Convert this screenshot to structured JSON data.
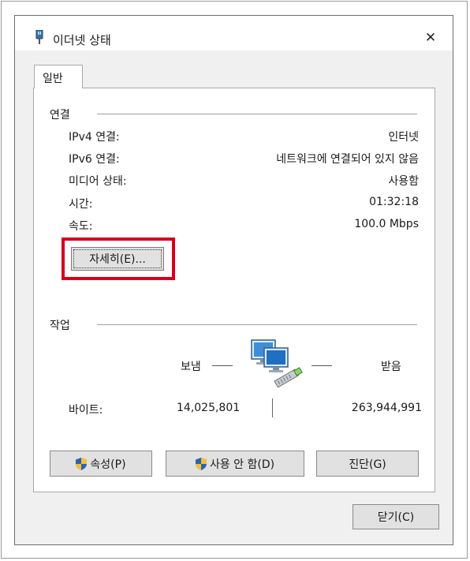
{
  "window": {
    "title": "이더넷 상태",
    "close_glyph": "✕",
    "icons": {
      "title": "ethernet-plug-icon",
      "close": "close-icon"
    }
  },
  "tabs": [
    {
      "label": "일반",
      "selected": true
    }
  ],
  "connection": {
    "heading": "연결",
    "rows": [
      {
        "label": "IPv4 연결:",
        "value": "인터넷"
      },
      {
        "label": "IPv6 연결:",
        "value": "네트워크에 연결되어 있지 않음"
      },
      {
        "label": "미디어 상태:",
        "value": "사용함"
      },
      {
        "label": "시간:",
        "value": "01:32:18"
      },
      {
        "label": "속도:",
        "value": "100.0 Mbps"
      }
    ],
    "details_button": "자세히(E)..."
  },
  "activity": {
    "heading": "작업",
    "sent_label": "보냄",
    "received_label": "받음",
    "bytes_label": "바이트:",
    "bytes_sent": "14,025,801",
    "bytes_received": "263,944,991",
    "icon": "network-computers-icon"
  },
  "buttons": {
    "properties": "속성(P)",
    "disable": "사용 안 함(D)",
    "diagnose": "진단(G)",
    "close": "닫기(C)",
    "shield_icon": "uac-shield-icon"
  },
  "colors": {
    "highlight_border": "#d6001c",
    "dialog_bg": "#f0f0f0",
    "button_bg": "#e1e1e1"
  }
}
